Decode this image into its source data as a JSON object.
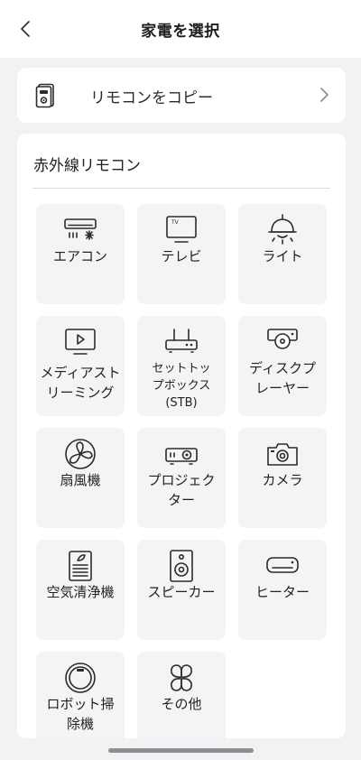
{
  "header": {
    "title": "家電を選択"
  },
  "copy_remote": {
    "label": "リモコンをコピー"
  },
  "ir_section": {
    "title": "赤外線リモコン",
    "devices": [
      {
        "label": "エアコン",
        "icon": "air-conditioner-icon"
      },
      {
        "label": "テレビ",
        "icon": "tv-icon"
      },
      {
        "label": "ライト",
        "icon": "light-icon"
      },
      {
        "label": "メディアスト\nリーミング",
        "icon": "media-streaming-icon"
      },
      {
        "label": "セットトッ\nプボックス\n(STB)",
        "icon": "set-top-box-icon"
      },
      {
        "label": "ディスクプ\nレーヤー",
        "icon": "disc-player-icon"
      },
      {
        "label": "扇風機",
        "icon": "fan-icon"
      },
      {
        "label": "プロジェク\nター",
        "icon": "projector-icon"
      },
      {
        "label": "カメラ",
        "icon": "camera-icon"
      },
      {
        "label": "空気清浄機",
        "icon": "air-purifier-icon"
      },
      {
        "label": "スピーカー",
        "icon": "speaker-icon"
      },
      {
        "label": "ヒーター",
        "icon": "heater-icon"
      },
      {
        "label": "ロボット掃\n除機",
        "icon": "robot-vacuum-icon"
      },
      {
        "label": "その他",
        "icon": "other-icon"
      }
    ]
  }
}
